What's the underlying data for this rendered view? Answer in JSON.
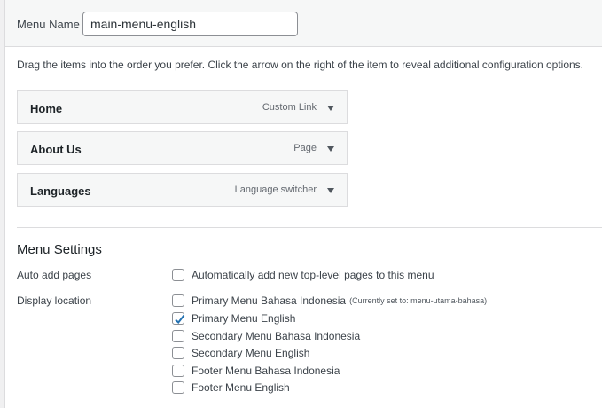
{
  "header": {
    "menu_name_label": "Menu Name",
    "menu_name_value": "main-menu-english"
  },
  "structure": {
    "instructions": "Drag the items into the order you prefer. Click the arrow on the right of the item to reveal additional configuration options.",
    "items": [
      {
        "title": "Home",
        "type": "Custom Link"
      },
      {
        "title": "About Us",
        "type": "Page"
      },
      {
        "title": "Languages",
        "type": "Language switcher"
      }
    ]
  },
  "settings": {
    "title": "Menu Settings",
    "auto_add": {
      "label": "Auto add pages",
      "option": "Automatically add new top-level pages to this menu",
      "checked": false
    },
    "display_location": {
      "label": "Display location",
      "options": [
        {
          "label": "Primary Menu Bahasa Indonesia",
          "note": "(Currently set to: menu-utama-bahasa)",
          "checked": false
        },
        {
          "label": "Primary Menu English",
          "note": "",
          "checked": true
        },
        {
          "label": "Secondary Menu Bahasa Indonesia",
          "note": "",
          "checked": false
        },
        {
          "label": "Secondary Menu English",
          "note": "",
          "checked": false
        },
        {
          "label": "Footer Menu Bahasa Indonesia",
          "note": "",
          "checked": false
        },
        {
          "label": "Footer Menu English",
          "note": "",
          "checked": false
        }
      ]
    }
  },
  "colors": {
    "accent": "#2271b1",
    "border": "#dcdcde",
    "item_bg": "#f6f7f7"
  }
}
